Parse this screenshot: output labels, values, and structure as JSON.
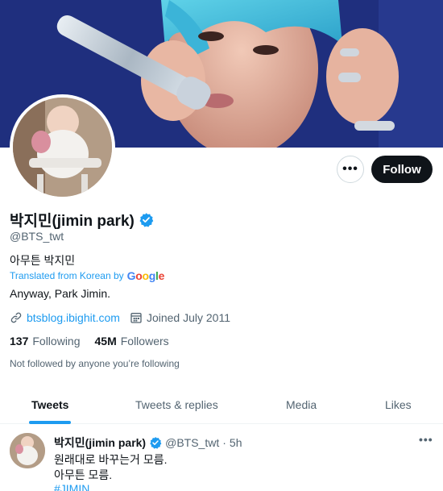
{
  "colors": {
    "accent": "#1d9bf0",
    "text": "#0f1419",
    "muted": "#536471",
    "follow_bg": "#0f1419"
  },
  "header": {
    "more_label": "•••",
    "follow_label": "Follow"
  },
  "profile": {
    "name": "박지민(jimin park)",
    "handle": "@BTS_twt",
    "bio": "아무튼 박지민",
    "translated_from": "Translated from Korean by",
    "translator_brand": [
      "G",
      "o",
      "o",
      "g",
      "l",
      "e"
    ],
    "translation": "Anyway, Park Jimin.",
    "website": "btsblog.ibighit.com",
    "joined": "Joined July 2011",
    "following_count": "137",
    "following_label": "Following",
    "followers_count": "45M",
    "followers_label": "Followers",
    "not_followed": "Not followed by anyone you’re following"
  },
  "tabs": [
    {
      "label": "Tweets",
      "active": true
    },
    {
      "label": "Tweets & replies",
      "active": false
    },
    {
      "label": "Media",
      "active": false
    },
    {
      "label": "Likes",
      "active": false
    }
  ],
  "tweet": {
    "name": "박지민(jimin park)",
    "handle": "@BTS_twt",
    "separator": "·",
    "time": "5h",
    "more": "•••",
    "line1": "원래대로 바꾸는거 모름.",
    "line2": "아무튼 모름.",
    "hashtag": "#JIMIN"
  },
  "icons": [
    "verified-badge-icon",
    "link-icon",
    "calendar-icon",
    "more-options-icon"
  ]
}
